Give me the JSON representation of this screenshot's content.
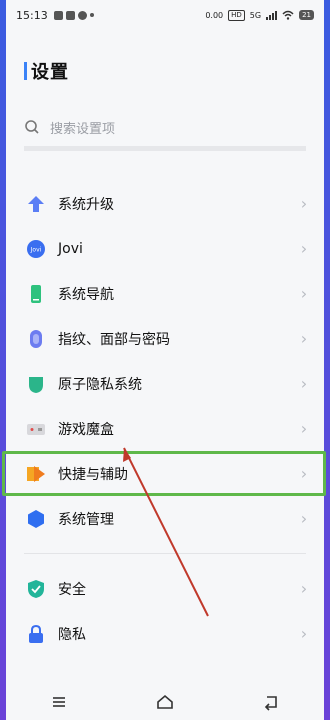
{
  "status_bar": {
    "time": "15:13",
    "net_speed": "0.00",
    "hd": "HD",
    "network": "5G",
    "battery": "21"
  },
  "page": {
    "title": "设置"
  },
  "search": {
    "placeholder": "搜索设置项"
  },
  "items": [
    {
      "label": "系统升级",
      "icon": "arrow-up-icon"
    },
    {
      "label": "Jovi",
      "icon": "jovi-icon"
    },
    {
      "label": "系统导航",
      "icon": "phone-icon"
    },
    {
      "label": "指纹、面部与密码",
      "icon": "fingerprint-icon"
    },
    {
      "label": "原子隐私系统",
      "icon": "shield-privacy-icon"
    },
    {
      "label": "游戏魔盒",
      "icon": "game-box-icon"
    },
    {
      "label": "快捷与辅助",
      "icon": "shortcut-icon",
      "highlighted": true
    },
    {
      "label": "系统管理",
      "icon": "hexagon-icon"
    }
  ],
  "items2": [
    {
      "label": "安全",
      "icon": "security-icon"
    },
    {
      "label": "隐私",
      "icon": "lock-icon"
    }
  ],
  "colors": {
    "accent": "#3a82f7",
    "highlight_border": "#5fb84a",
    "annotation_arrow": "#c0392b"
  },
  "icons": [
    "search-icon",
    "chevron-right-icon",
    "menu-icon",
    "home-icon",
    "back-icon"
  ]
}
